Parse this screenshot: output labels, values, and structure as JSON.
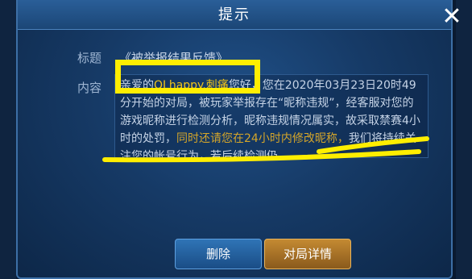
{
  "dialog": {
    "title": "提示",
    "close_glyph": "✕",
    "title_label": "标题",
    "title_value": "《被举报结果反馈》",
    "content_label": "内容",
    "content": {
      "part1": "亲爱的",
      "name": "QLhappy.刺痛",
      "part2": "您好，您在2020年03月23日20时49分开始的对局，被玩家举报存在“昵称违规”，经客服对您的游戏昵称进行检测分析，昵称违规情况属实，故采取禁赛4小时的处罚，",
      "part3": "同时还请您在24小时内修改昵称，",
      "part4": "我们将持续关注您的帐号行为，若后续检测仍"
    }
  },
  "buttons": {
    "delete": "删除",
    "detail": "对局详情"
  },
  "annotation_color": "#ffee00"
}
